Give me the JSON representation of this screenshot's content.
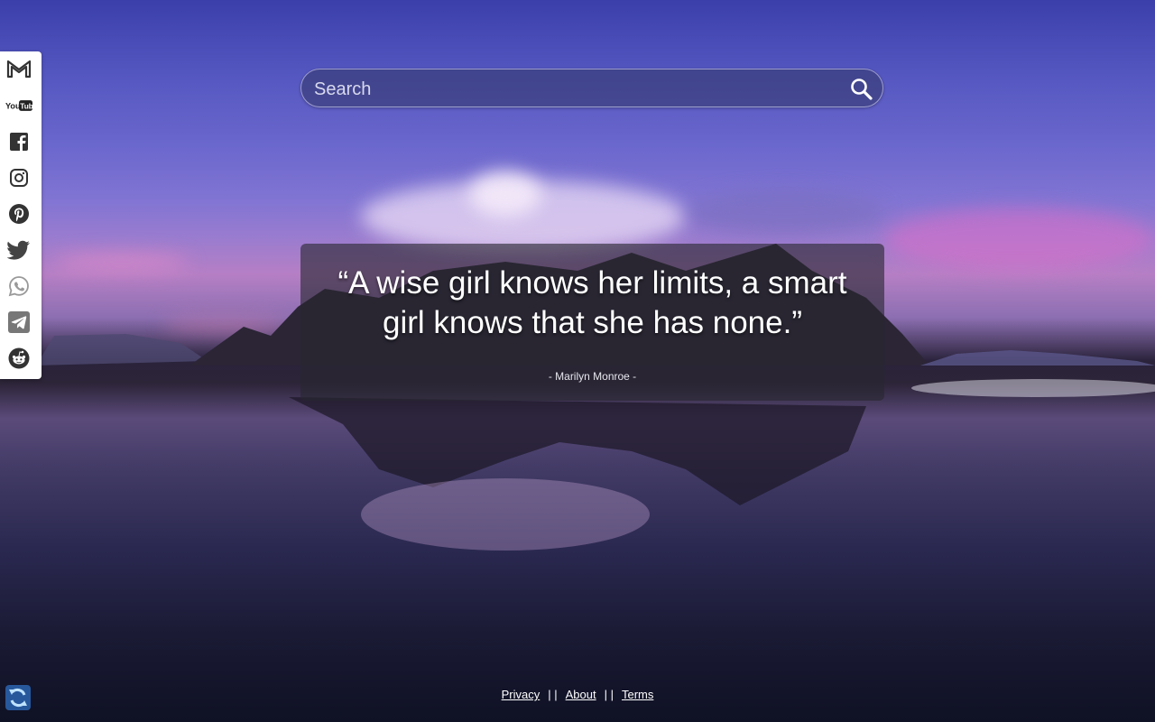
{
  "search": {
    "placeholder": "Search"
  },
  "quote": {
    "text": "“A wise girl knows her limits, a smart girl knows that she has none.”",
    "author": "- Marilyn Monroe -"
  },
  "footer": {
    "privacy": "Privacy",
    "about": "About",
    "terms": "Terms",
    "separator": "| |"
  },
  "social": [
    {
      "name": "gmail-icon"
    },
    {
      "name": "youtube-icon",
      "label": "YouTube"
    },
    {
      "name": "facebook-icon"
    },
    {
      "name": "instagram-icon"
    },
    {
      "name": "pinterest-icon"
    },
    {
      "name": "twitter-icon"
    },
    {
      "name": "whatsapp-icon"
    },
    {
      "name": "telegram-icon"
    },
    {
      "name": "reddit-icon"
    }
  ],
  "colors": {
    "sky_top": "#3b3fa9",
    "sky_pink": "#b67fc5",
    "beach_dark": "#2a233b",
    "quote_box": "#282630"
  }
}
